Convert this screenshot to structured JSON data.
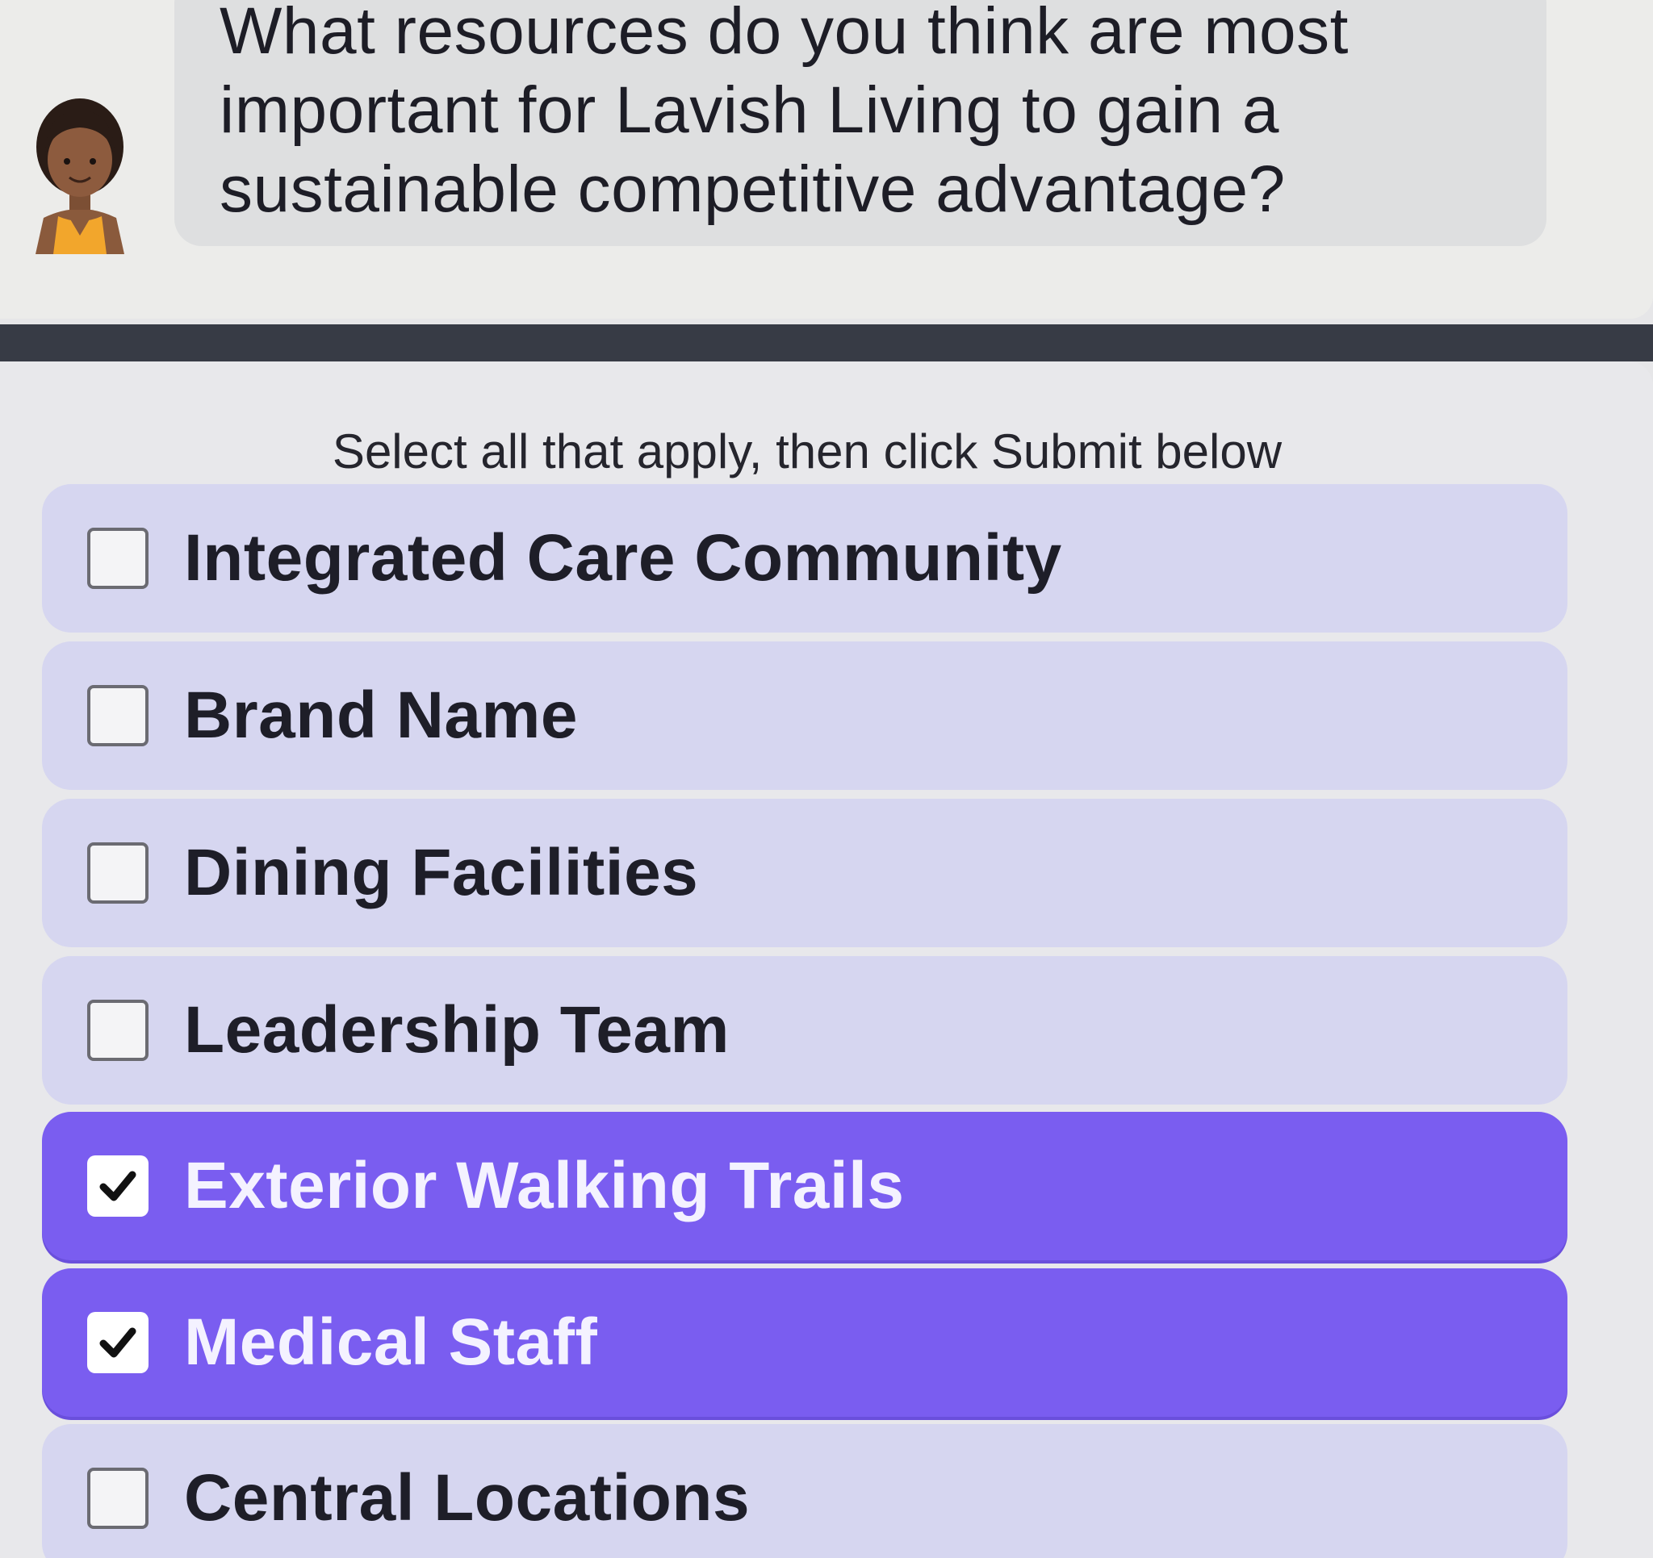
{
  "question": {
    "text": "What resources do you think are most important for Lavish Living to gain a sustainable competitive advantage?",
    "avatar_icon": "woman-avatar-icon"
  },
  "instruction": "Select all that apply, then click Submit below",
  "options": [
    {
      "label": "Integrated Care Community",
      "checked": false
    },
    {
      "label": "Brand Name",
      "checked": false
    },
    {
      "label": "Dining Facilities",
      "checked": false
    },
    {
      "label": "Leadership Team",
      "checked": false
    },
    {
      "label": "Exterior Walking Trails",
      "checked": true
    },
    {
      "label": "Medical Staff",
      "checked": true
    },
    {
      "label": "Central Locations",
      "checked": false
    }
  ],
  "colors": {
    "selected_option": "#7a5df0",
    "unselected_option": "#d6d6f0",
    "divider": "#373b45"
  }
}
